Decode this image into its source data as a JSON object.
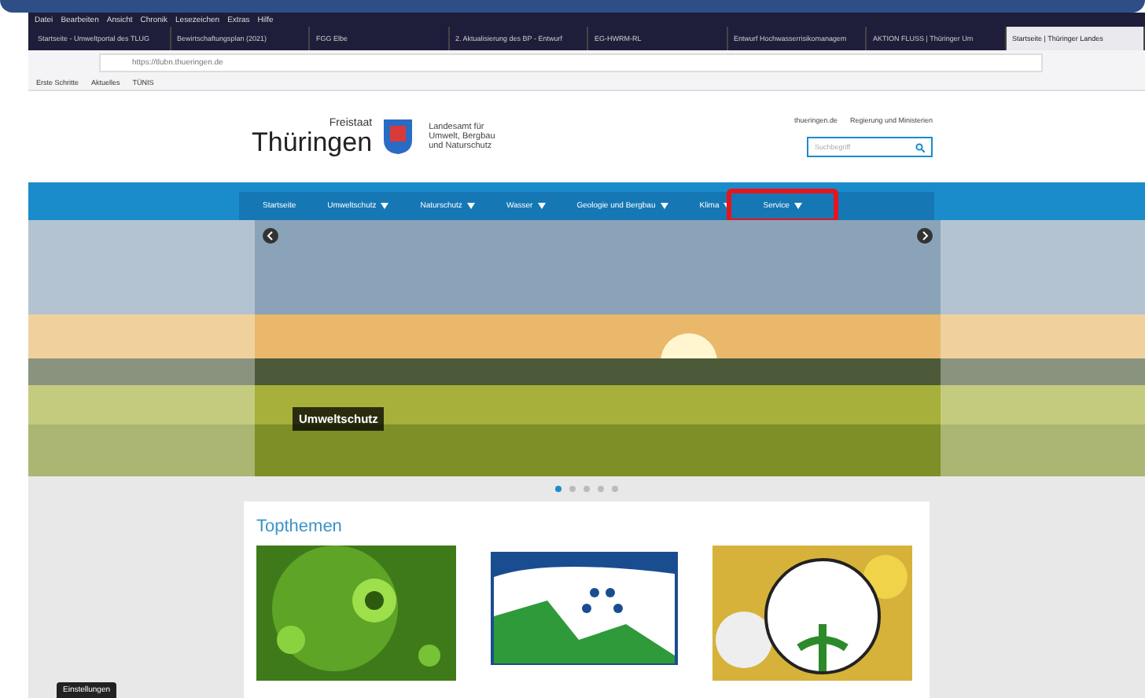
{
  "menu_bar": [
    "Datei",
    "Bearbeiten",
    "Ansicht",
    "Chronik",
    "Lesezeichen",
    "Extras",
    "Hilfe"
  ],
  "tabs": [
    {
      "label": "Startseite - Umweltportal des TLUG",
      "selected": false
    },
    {
      "label": "Bewirtschaftungsplan (2021)",
      "selected": false
    },
    {
      "label": "FGG Elbe",
      "selected": false
    },
    {
      "label": "2. Aktualisierung des BP - Entwurf",
      "selected": false
    },
    {
      "label": "EG-HWRM-RL",
      "selected": false
    },
    {
      "label": "Entwurf Hochwasserrisikomanagem",
      "selected": false
    },
    {
      "label": "AKTION FLUSS | Thüringer Um",
      "selected": false
    },
    {
      "label": "Startseite | Thüringer Landes",
      "selected": true
    }
  ],
  "address": "https://tlubn.thueringen.de",
  "bookmarks": [
    "Erste Schritte",
    "Aktuelles",
    "TÜNIS"
  ],
  "site": {
    "state": "Freistaat",
    "name": "Thüringen",
    "agency": [
      "Landesamt für",
      "Umwelt, Bergbau",
      "und Naturschutz"
    ],
    "top_links": [
      "thueringen.de",
      "Regierung und Ministerien"
    ],
    "search_placeholder": "Suchbegriff",
    "nav": [
      {
        "label": "Startseite",
        "dropdown": false,
        "highlighted": false
      },
      {
        "label": "Umweltschutz",
        "dropdown": true,
        "highlighted": false
      },
      {
        "label": "Naturschutz",
        "dropdown": true,
        "highlighted": false
      },
      {
        "label": "Wasser",
        "dropdown": true,
        "highlighted": false
      },
      {
        "label": "Geologie und Bergbau",
        "dropdown": true,
        "highlighted": false
      },
      {
        "label": "Klima",
        "dropdown": true,
        "highlighted": false
      },
      {
        "label": "Service",
        "dropdown": true,
        "highlighted": true
      }
    ],
    "slide_caption": "Umweltschutz",
    "slide_dots": [
      {
        "selected": true
      },
      {
        "selected": false
      },
      {
        "selected": false
      },
      {
        "selected": false
      },
      {
        "selected": false
      }
    ],
    "section_title": "Topthemen",
    "cards": [
      {
        "kind": "virus"
      },
      {
        "kind": "natura"
      },
      {
        "kind": "foj"
      }
    ],
    "settings_button": "Einstellungen"
  }
}
